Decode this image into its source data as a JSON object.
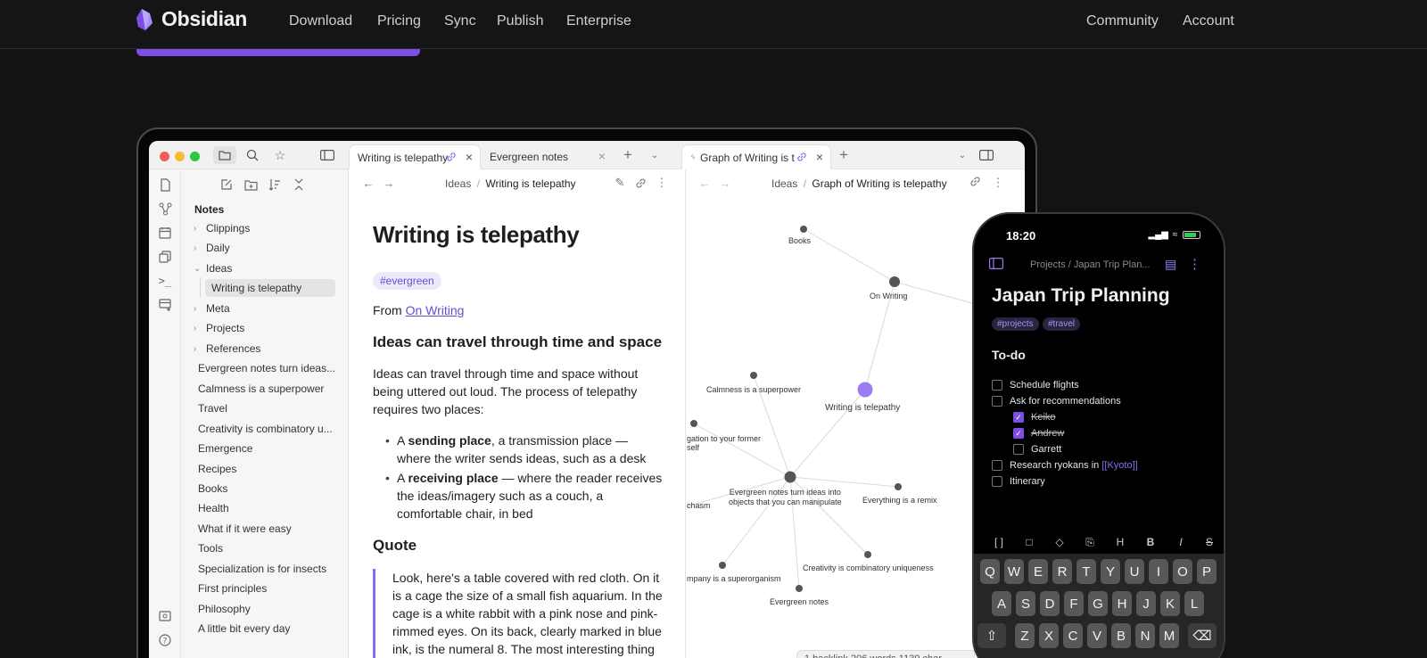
{
  "nav": {
    "brand": "Obsidian",
    "links": [
      "Download",
      "Pricing",
      "Sync",
      "Publish",
      "Enterprise"
    ],
    "right_links": [
      "Community",
      "Account"
    ]
  },
  "desktop": {
    "tabs": {
      "left_tab": "Writing is telepathy",
      "second_tab": "Evergreen notes",
      "right_tab": "Graph of Writing is t"
    },
    "sidebar": {
      "heading": "Notes",
      "folders": [
        {
          "label": "Clippings",
          "expanded": false
        },
        {
          "label": "Daily",
          "expanded": false
        },
        {
          "label": "Ideas",
          "expanded": true
        }
      ],
      "selected_note": "Writing is telepathy",
      "folders_after": [
        "Meta",
        "Projects",
        "References"
      ],
      "notes": [
        "Evergreen notes turn ideas...",
        "Calmness is a superpower",
        "Travel",
        "Creativity is combinatory u...",
        "Emergence",
        "Recipes",
        "Books",
        "Health",
        "What if it were easy",
        "Tools",
        "Specialization is for insects",
        "First principles",
        "Philosophy",
        "A little bit every day"
      ]
    },
    "editor": {
      "breadcrumb_folder": "Ideas",
      "breadcrumb_sep": "/",
      "breadcrumb_note": "Writing is telepathy",
      "title": "Writing is telepathy",
      "tag": "#evergreen",
      "from_label": "From",
      "from_link": "On Writing",
      "h2_1": "Ideas can travel through time and space",
      "para1": "Ideas can travel through time and space without being uttered out loud. The process of telepathy requires two places:",
      "bullet1_pre": "A ",
      "bullet1_bold": "sending place",
      "bullet1_post": ", a transmission place — where the writer sends ideas, such as a desk",
      "bullet2_pre": "A ",
      "bullet2_bold": "receiving place",
      "bullet2_post": " — where the reader receives the ideas/imagery such as a couch, a comfortable chair, in bed",
      "h2_2": "Quote",
      "quote": "Look, here's a table covered with red cloth. On it is a cage the size of a small fish aquarium. In the cage is a white rabbit with a pink nose and pink-rimmed eyes. On its back, clearly marked in blue ink, is the numeral 8. The most interesting thing"
    },
    "graph": {
      "breadcrumb_folder": "Ideas",
      "breadcrumb_sep": "/",
      "breadcrumb_note": "Graph of Writing is telepathy",
      "nodes": {
        "books": "Books",
        "on_writing": "On Writing",
        "calmness": "Calmness is a superpower",
        "telepathy": "Writing is telepathy",
        "obligation": "gation to your former\nself",
        "evergreen_turn": "Evergreen notes turn ideas into\nobjects that you can manipulate",
        "remix": "Everything is a remix",
        "chasm": "chasm",
        "creativity": "Creativity is combinatory uniqueness",
        "superorganism": "mpany is a superorganism",
        "evergreen": "Evergreen notes"
      },
      "status_bar": "1 backlink   206 words  1139 char"
    }
  },
  "phone": {
    "time": "18:20",
    "breadcrumb": "Projects / Japan Trip Plan...",
    "title": "Japan Trip Planning",
    "tags": [
      "#projects",
      "#travel"
    ],
    "heading": "To-do",
    "tasks": {
      "t1": "Schedule flights",
      "t2": "Ask for recommendations",
      "t3": "Keiko",
      "t4": "Andrew",
      "t5": "Garrett",
      "t6_pre": "Research ryokans in ",
      "t6_link": "[[Kyoto]]",
      "t7": "Itinerary"
    },
    "toolbar": [
      "[ ]",
      "□",
      "◇",
      "⎘",
      "H",
      "B",
      "I",
      "S"
    ],
    "keyboard": {
      "row1": [
        "Q",
        "W",
        "E",
        "R",
        "T",
        "Y",
        "U",
        "I",
        "O",
        "P"
      ],
      "row2": [
        "A",
        "S",
        "D",
        "F",
        "G",
        "H",
        "J",
        "K",
        "L"
      ],
      "row3": [
        "Z",
        "X",
        "C",
        "V",
        "B",
        "N",
        "M"
      ]
    }
  }
}
